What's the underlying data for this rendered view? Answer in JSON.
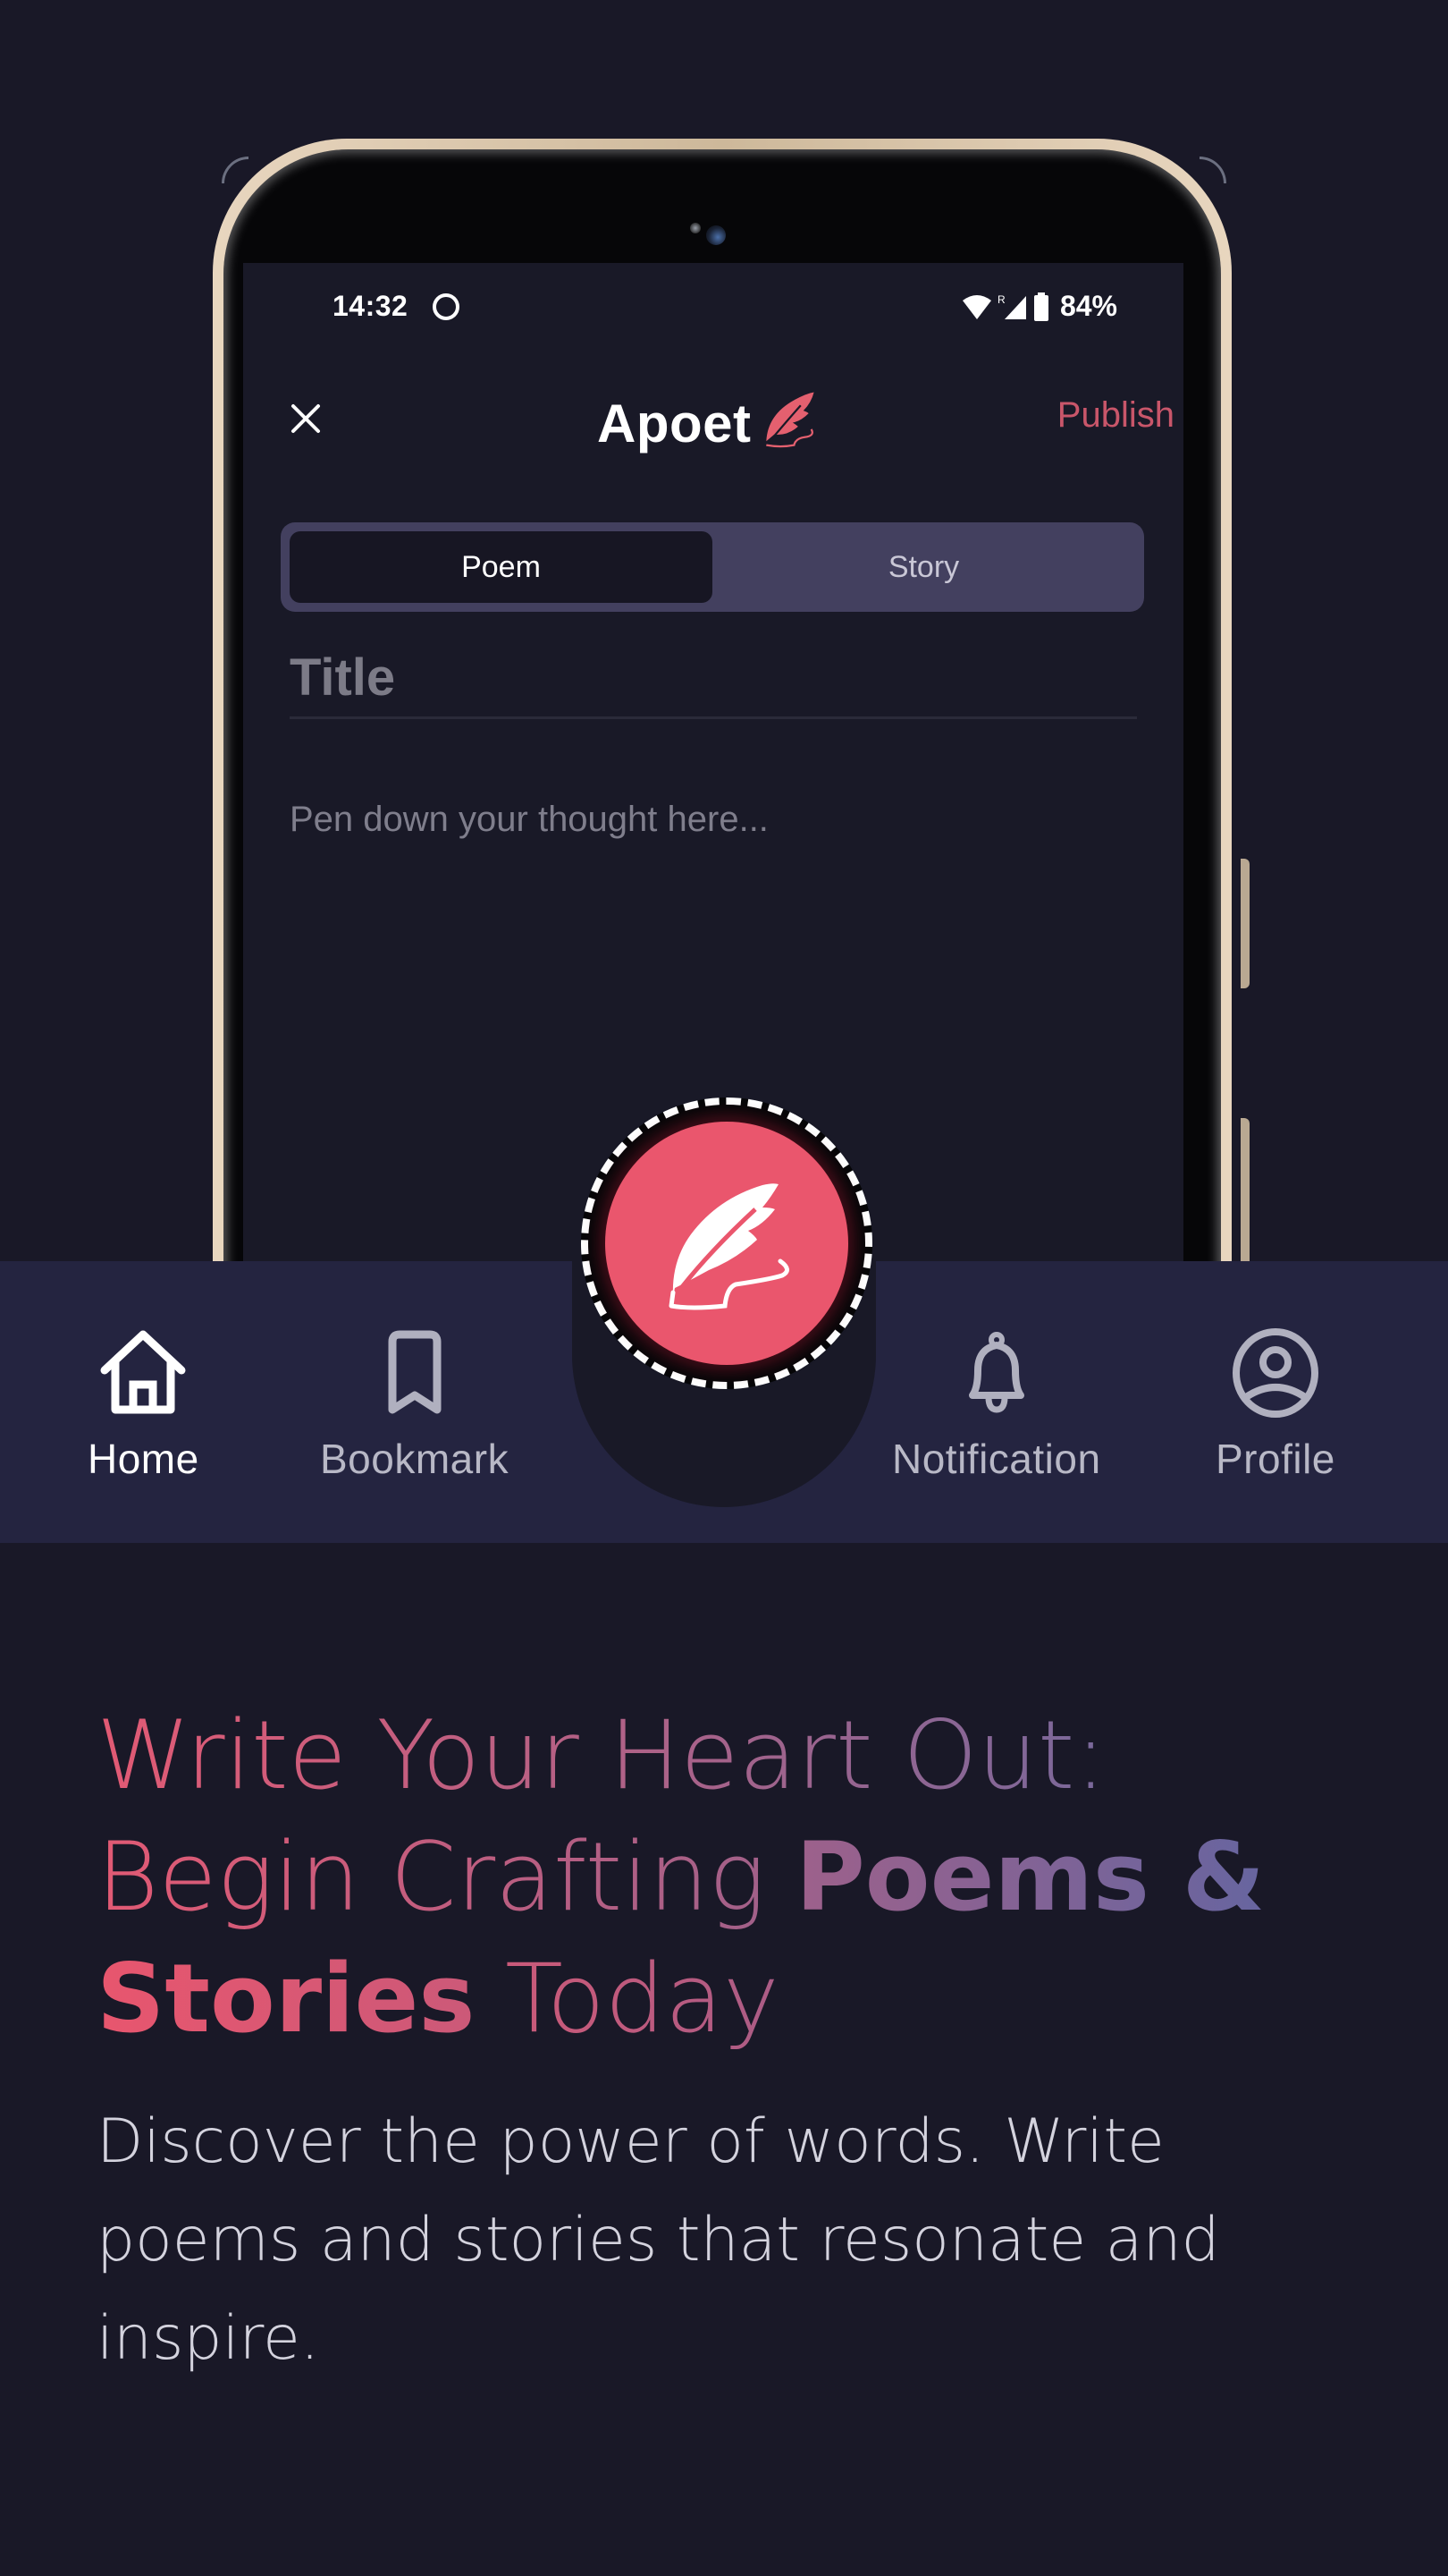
{
  "status_bar": {
    "time": "14:32",
    "battery": "84%",
    "icons": [
      "app-notification-icon",
      "wifi-icon",
      "signal-icon",
      "battery-icon"
    ]
  },
  "app_bar": {
    "brand": "Apoet",
    "publish_label": "Publish",
    "close_icon": "close-icon"
  },
  "segmented": {
    "options": [
      "Poem",
      "Story"
    ],
    "selected": "Poem"
  },
  "editor": {
    "title_placeholder": "Title",
    "body_placeholder": "Pen down your thought here..."
  },
  "bottom_nav": {
    "items": [
      {
        "label": "Home",
        "icon": "home-icon",
        "active": true
      },
      {
        "label": "Bookmark",
        "icon": "bookmark-icon",
        "active": false
      },
      {
        "label": "Notification",
        "icon": "bell-icon",
        "active": false
      },
      {
        "label": "Profile",
        "icon": "profile-icon",
        "active": false
      }
    ],
    "fab_icon": "quill-icon"
  },
  "headline": {
    "line1": "Write Your Heart Out:",
    "line2_light": "Begin Crafting ",
    "line2_bold": "Poems &",
    "line3_bold": "Stories",
    "line3_light": " Today"
  },
  "description": "Discover the power of words. Write poems and stories that resonate and inspire.",
  "colors": {
    "background": "#191827",
    "accent": "#ea566d",
    "publish": "#c9566a",
    "nav_bg": "#242440",
    "segment_bg": "#43405f",
    "gradient_start": "#e8566e",
    "gradient_end": "#5f64a0"
  }
}
